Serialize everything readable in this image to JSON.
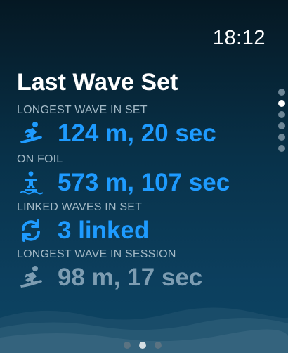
{
  "status_bar": {
    "time": "18:12"
  },
  "screen": {
    "title": "Last Wave Set"
  },
  "metrics": [
    {
      "label": "LONGEST WAVE IN SET",
      "value": "124 m, 20 sec",
      "icon": "surfer-icon"
    },
    {
      "label": "ON FOIL",
      "value": "573 m, 107 sec",
      "icon": "foil-surfer-icon"
    },
    {
      "label": "LINKED WAVES IN SET",
      "value": "3 linked",
      "icon": "linked-arrows-icon"
    },
    {
      "label": "LONGEST WAVE IN SESSION",
      "value": "98 m, 17 sec",
      "icon": "surfer-icon"
    }
  ],
  "pagination": {
    "vertical": {
      "count": 6,
      "active_index": 1
    },
    "horizontal": {
      "count": 3,
      "active_index": 1
    }
  },
  "colors": {
    "accent": "#1e9bff",
    "dim_value": "#7d9db2",
    "label": "#a3b9c6"
  }
}
